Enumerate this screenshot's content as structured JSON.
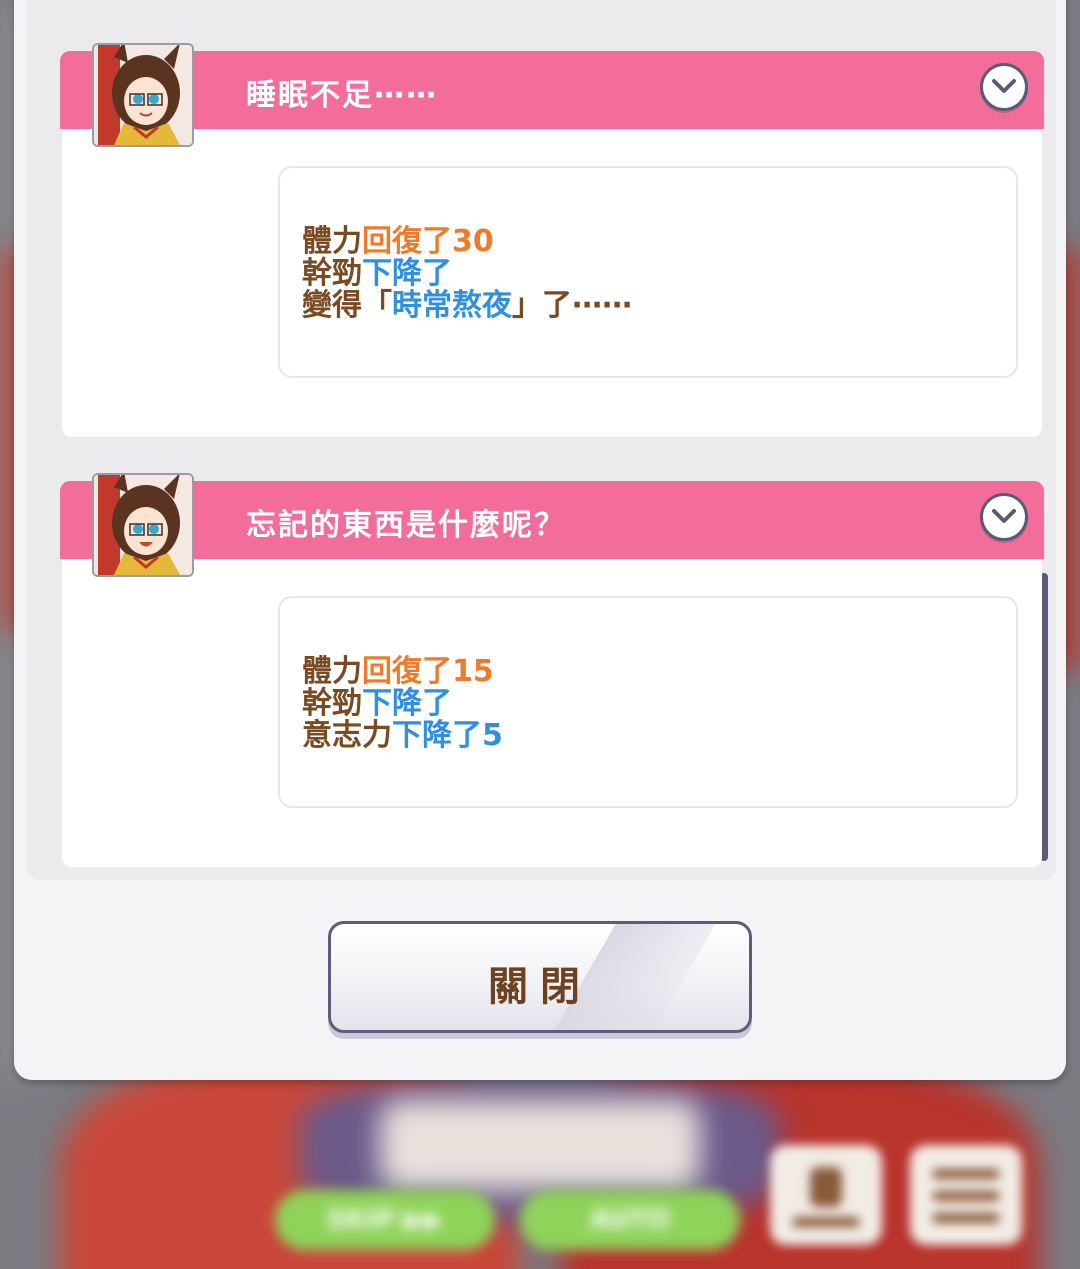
{
  "events": [
    {
      "title": "睡眠不足⋯⋯",
      "lines": [
        [
          {
            "text": "體力",
            "color": "brown"
          },
          {
            "text": "回復了30",
            "color": "orange"
          }
        ],
        [
          {
            "text": "幹勁",
            "color": "brown"
          },
          {
            "text": "下降了",
            "color": "blue"
          }
        ],
        [
          {
            "text": "變得「",
            "color": "brown"
          },
          {
            "text": "時常熬夜",
            "color": "blue"
          },
          {
            "text": "」了⋯⋯",
            "color": "brown"
          }
        ]
      ]
    },
    {
      "title": "忘記的東西是什麼呢？",
      "lines": [
        [
          {
            "text": "體力",
            "color": "brown"
          },
          {
            "text": "回復了15",
            "color": "orange"
          }
        ],
        [
          {
            "text": "幹勁",
            "color": "brown"
          },
          {
            "text": "下降了",
            "color": "blue"
          }
        ],
        [
          {
            "text": "意志力",
            "color": "brown"
          },
          {
            "text": "下降了5",
            "color": "blue"
          }
        ]
      ]
    }
  ],
  "close_label": "關閉",
  "background_buttons": {
    "skip": "SKIP ▶▶",
    "auto": "AUTO"
  },
  "colors": {
    "title_bar": "#f36d9a",
    "brown": "#7a4a22",
    "orange": "#ee7a2a",
    "blue": "#2f8fe0",
    "accent_green": "#8fd35a"
  },
  "icons": [
    "chevron-down-icon",
    "character-portrait",
    "log-icon",
    "menu-icon"
  ]
}
